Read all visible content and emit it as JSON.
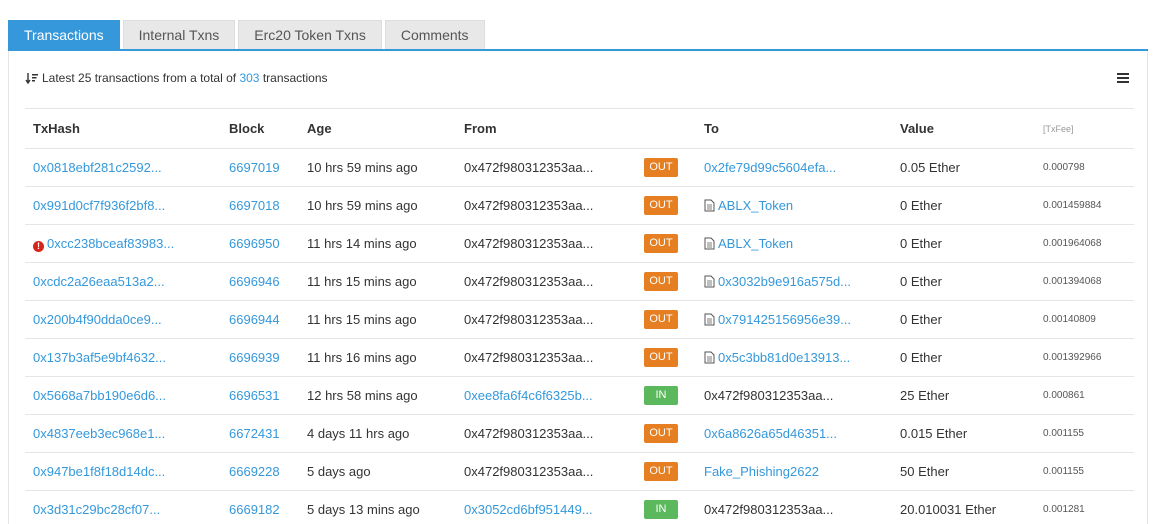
{
  "tabs": [
    {
      "label": "Transactions",
      "active": true
    },
    {
      "label": "Internal Txns",
      "active": false
    },
    {
      "label": "Erc20 Token Txns",
      "active": false
    },
    {
      "label": "Comments",
      "active": false
    }
  ],
  "summary": {
    "prefix": "Latest 25 transactions from a total of",
    "total": "303",
    "suffix": "transactions"
  },
  "columns": {
    "txhash": "TxHash",
    "block": "Block",
    "age": "Age",
    "from": "From",
    "to": "To",
    "value": "Value",
    "fee": "[TxFee]"
  },
  "rows": [
    {
      "txhash": "0x0818ebf281c2592...",
      "error": false,
      "block": "6697019",
      "age": "10 hrs 59 mins ago",
      "from": "0x472f980312353aa...",
      "from_link": false,
      "dir": "OUT",
      "to": "0x2fe79d99c5604efa...",
      "to_contract": false,
      "to_link": true,
      "value": "0.05 Ether",
      "fee": "0.000798"
    },
    {
      "txhash": "0x991d0cf7f936f2bf8...",
      "error": false,
      "block": "6697018",
      "age": "10 hrs 59 mins ago",
      "from": "0x472f980312353aa...",
      "from_link": false,
      "dir": "OUT",
      "to": "ABLX_Token",
      "to_contract": true,
      "to_link": true,
      "value": "0 Ether",
      "fee": "0.001459884"
    },
    {
      "txhash": "0xcc238bceaf83983...",
      "error": true,
      "block": "6696950",
      "age": "11 hrs 14 mins ago",
      "from": "0x472f980312353aa...",
      "from_link": false,
      "dir": "OUT",
      "to": "ABLX_Token",
      "to_contract": true,
      "to_link": true,
      "value": "0 Ether",
      "fee": "0.001964068"
    },
    {
      "txhash": "0xcdc2a26eaa513a2...",
      "error": false,
      "block": "6696946",
      "age": "11 hrs 15 mins ago",
      "from": "0x472f980312353aa...",
      "from_link": false,
      "dir": "OUT",
      "to": "0x3032b9e916a575d...",
      "to_contract": true,
      "to_link": true,
      "value": "0 Ether",
      "fee": "0.001394068"
    },
    {
      "txhash": "0x200b4f90dda0ce9...",
      "error": false,
      "block": "6696944",
      "age": "11 hrs 15 mins ago",
      "from": "0x472f980312353aa...",
      "from_link": false,
      "dir": "OUT",
      "to": "0x791425156956e39...",
      "to_contract": true,
      "to_link": true,
      "value": "0 Ether",
      "fee": "0.00140809"
    },
    {
      "txhash": "0x137b3af5e9bf4632...",
      "error": false,
      "block": "6696939",
      "age": "11 hrs 16 mins ago",
      "from": "0x472f980312353aa...",
      "from_link": false,
      "dir": "OUT",
      "to": "0x5c3bb81d0e13913...",
      "to_contract": true,
      "to_link": true,
      "value": "0 Ether",
      "fee": "0.001392966"
    },
    {
      "txhash": "0x5668a7bb190e6d6...",
      "error": false,
      "block": "6696531",
      "age": "12 hrs 58 mins ago",
      "from": "0xee8fa6f4c6f6325b...",
      "from_link": true,
      "dir": "IN",
      "to": "0x472f980312353aa...",
      "to_contract": false,
      "to_link": false,
      "value": "25 Ether",
      "fee": "0.000861"
    },
    {
      "txhash": "0x4837eeb3ec968e1...",
      "error": false,
      "block": "6672431",
      "age": "4 days 11 hrs ago",
      "from": "0x472f980312353aa...",
      "from_link": false,
      "dir": "OUT",
      "to": "0x6a8626a65d46351...",
      "to_contract": false,
      "to_link": true,
      "value": "0.015 Ether",
      "fee": "0.001155"
    },
    {
      "txhash": "0x947be1f8f18d14dc...",
      "error": false,
      "block": "6669228",
      "age": "5 days ago",
      "from": "0x472f980312353aa...",
      "from_link": false,
      "dir": "OUT",
      "to": "Fake_Phishing2622",
      "to_contract": false,
      "to_link": true,
      "value": "50 Ether",
      "fee": "0.001155"
    },
    {
      "txhash": "0x3d31c29bc28cf07...",
      "error": false,
      "block": "6669182",
      "age": "5 days 13 mins ago",
      "from": "0x3052cd6bf951449...",
      "from_link": true,
      "dir": "IN",
      "to": "0x472f980312353aa...",
      "to_contract": false,
      "to_link": false,
      "value": "20.010031 Ether",
      "fee": "0.001281"
    }
  ]
}
